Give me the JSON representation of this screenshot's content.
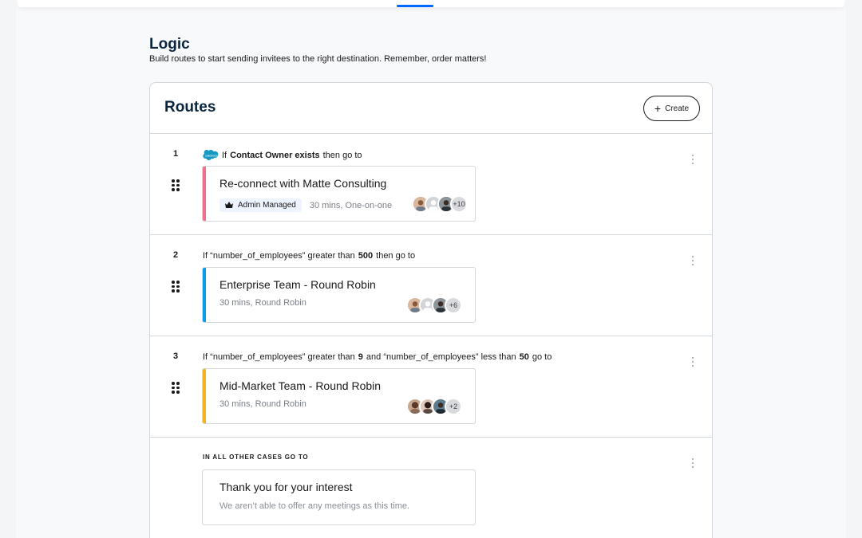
{
  "page": {
    "title": "Logic",
    "subtitle": "Build routes to start sending invitees to the right destination. Remember, order matters!"
  },
  "routes_panel": {
    "title": "Routes",
    "create_label": "Create"
  },
  "routes": [
    {
      "number": "1",
      "condition_parts": [
        "If ",
        "Contact Owner exists",
        " then go to"
      ],
      "has_salesforce_icon": true,
      "event": {
        "title": "Re-connect with Matte Consulting",
        "badge": "Admin Managed",
        "meta": "30 mins, One-on-one",
        "stripe_color": "#f0708a",
        "more_count": "+10"
      }
    },
    {
      "number": "2",
      "condition_parts": [
        "If “number_of_employees” greater than ",
        "500",
        " then go to"
      ],
      "event": {
        "title": "Enterprise Team - Round Robin",
        "meta": "30 mins, Round Robin",
        "stripe_color": "#0a9af0",
        "more_count": "+6"
      }
    },
    {
      "number": "3",
      "condition_parts": [
        "If “number_of_employees” greater than ",
        "9",
        " and “number_of_employees” less than ",
        "50",
        " go to"
      ],
      "event": {
        "title": "Mid-Market Team - Round Robin",
        "meta": "30 mins, Round Robin",
        "stripe_color": "#f5b21b",
        "more_count": "+2"
      }
    }
  ],
  "default_route": {
    "label": "IN ALL OTHER CASES GO TO",
    "title": "Thank you for your interest",
    "subtitle": "We aren’t able to offer any meetings as this time."
  }
}
